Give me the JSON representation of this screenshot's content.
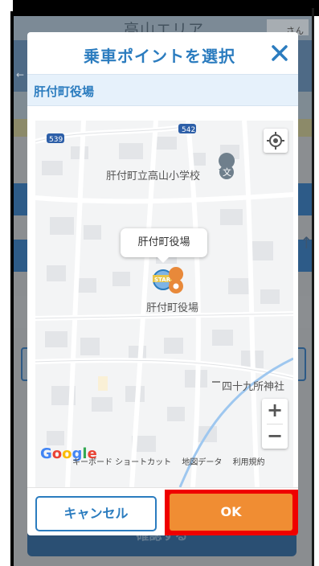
{
  "background": {
    "title": "高山エリア",
    "user_suffix": "さん",
    "confirm_label": "確認する"
  },
  "modal": {
    "title": "乗車ポイントを選択",
    "selected_location": "肝付町役場",
    "cancel_label": "キャンセル",
    "ok_label": "OK"
  },
  "map": {
    "road_badges": [
      "539",
      "542"
    ],
    "labels": {
      "school": "肝付町立高山小学校",
      "town_hall": "肝付町役場",
      "shrine": "四十九所神社"
    },
    "tooltip": "肝付町役場",
    "start_marker": "START",
    "zoom_in": "+",
    "zoom_out": "−",
    "google_logo": "Google",
    "attribution": {
      "keyboard": "キーボード ショートカット",
      "map_data": "地図データ",
      "terms": "利用規約"
    }
  },
  "colors": {
    "accent_blue": "#2b7cbf",
    "ok_orange": "#f08d33",
    "highlight_red": "#ef0000"
  }
}
